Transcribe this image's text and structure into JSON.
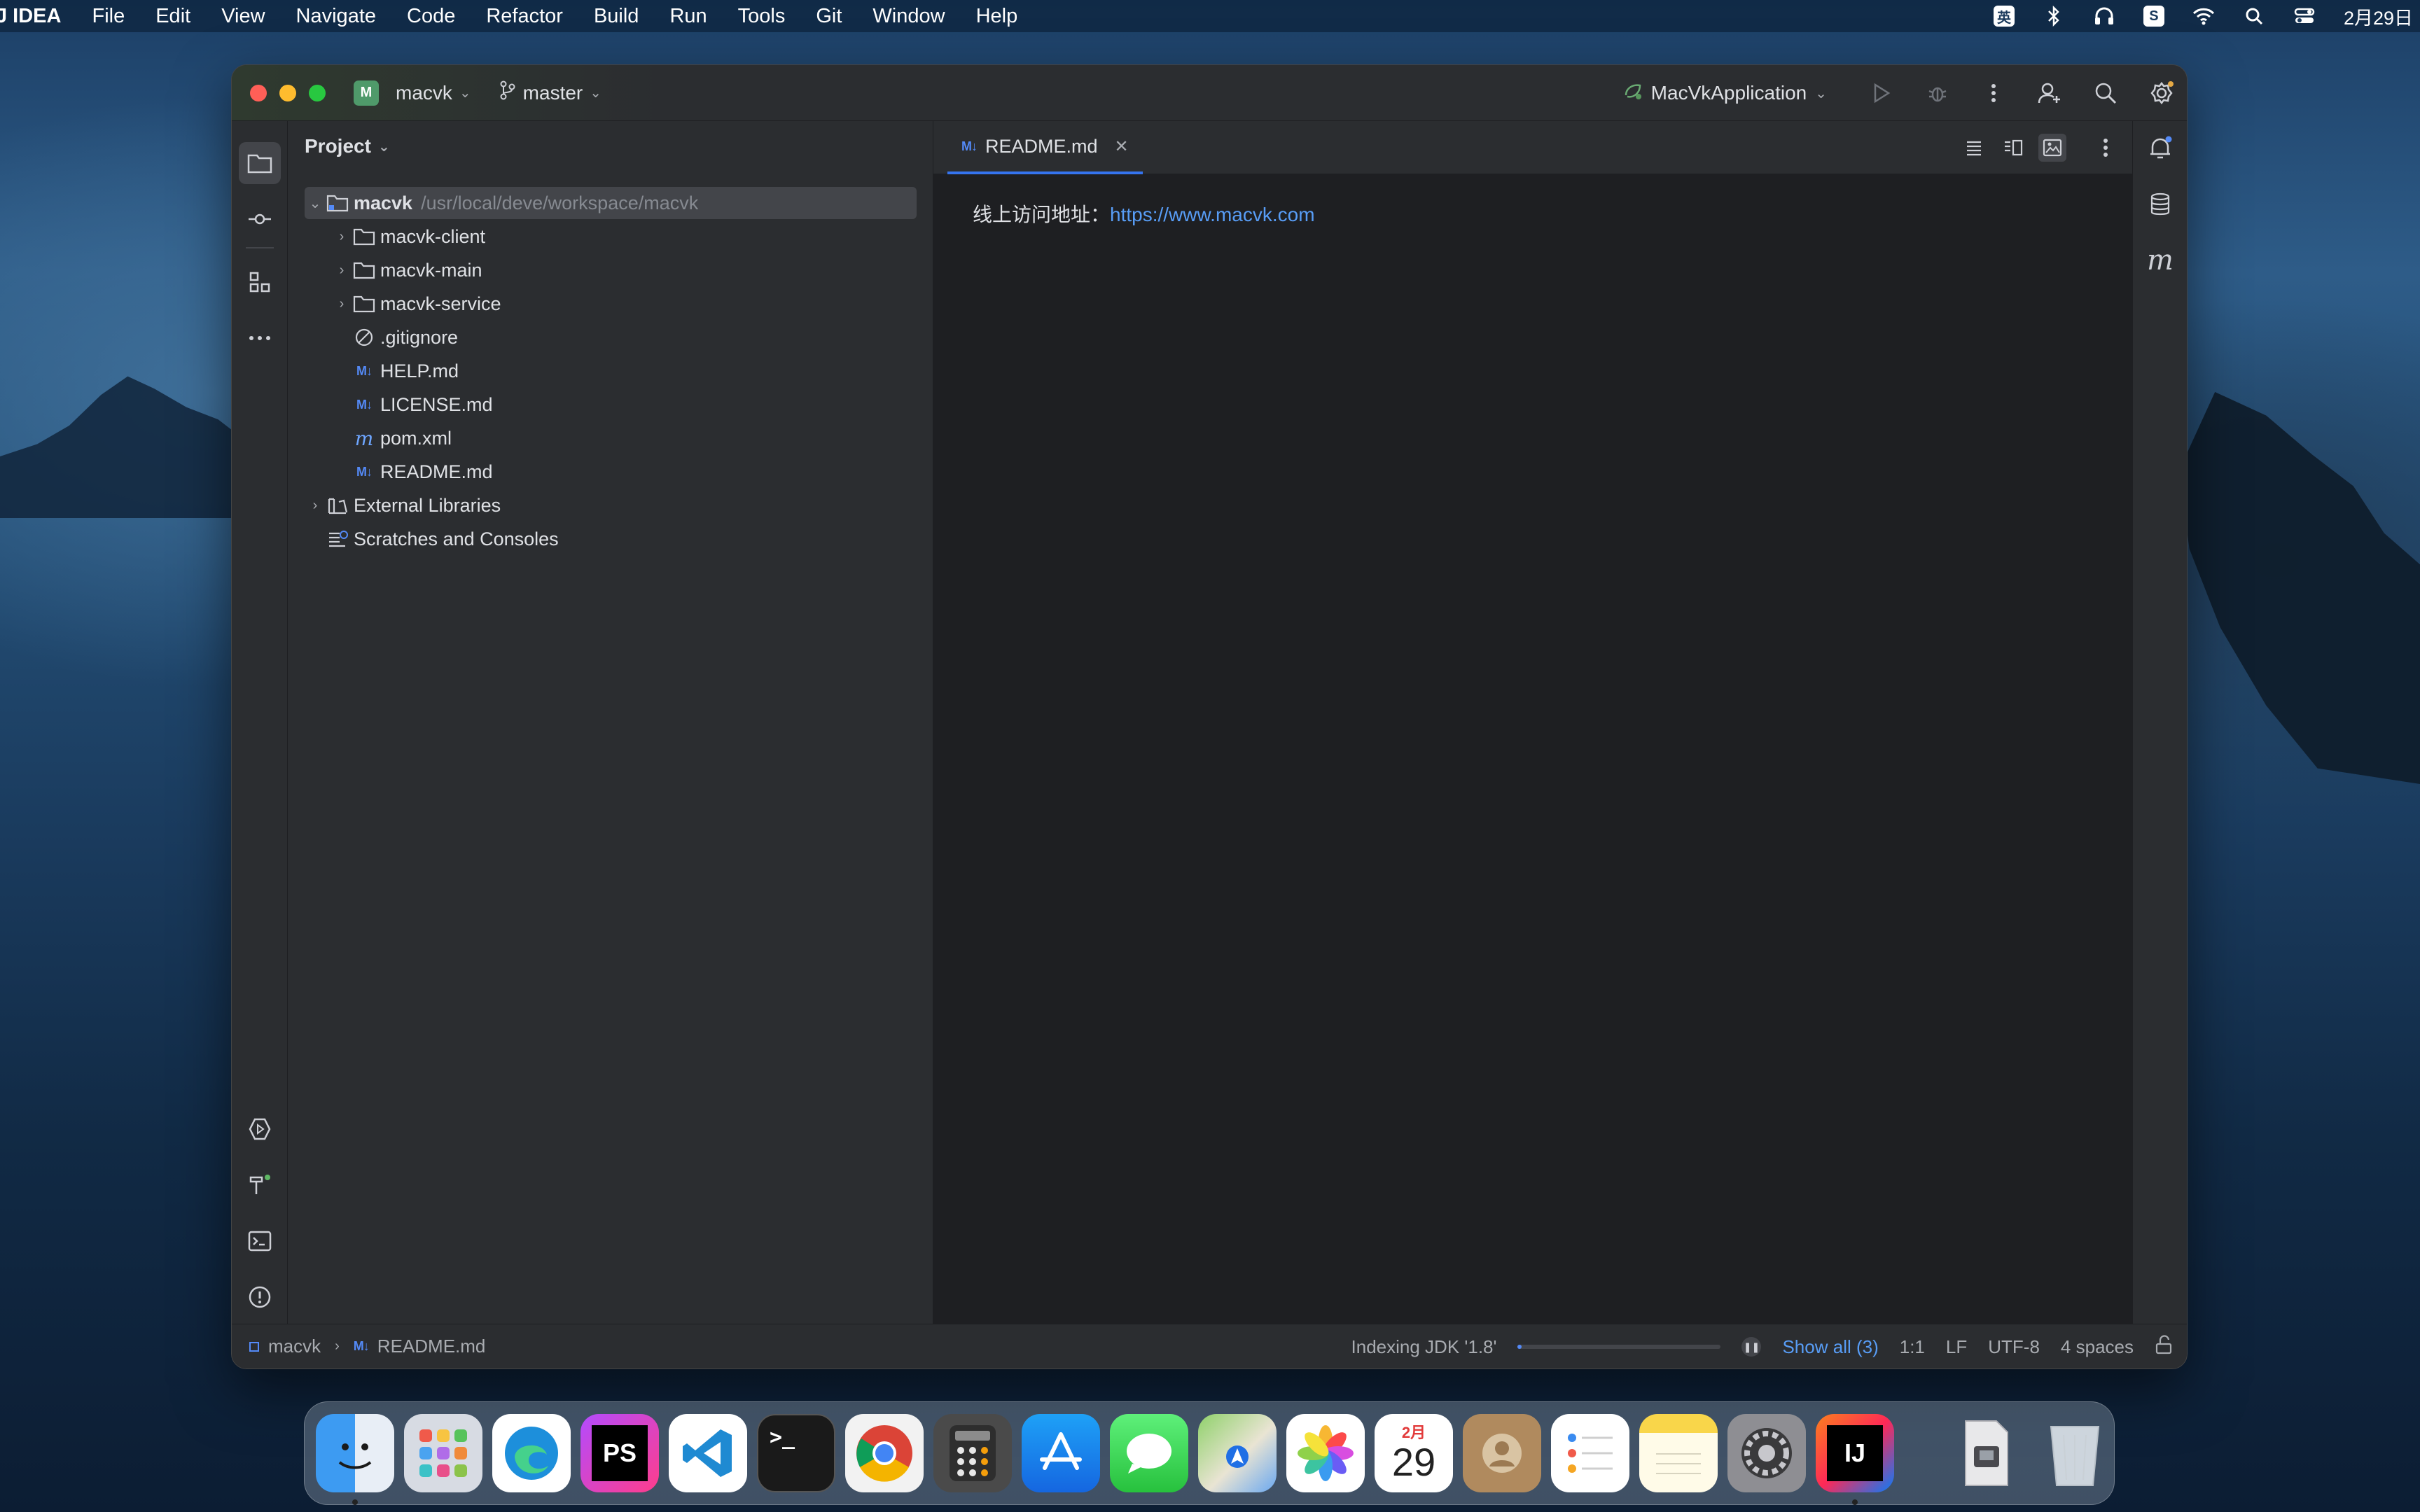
{
  "menubar": {
    "app_name": "J IDEA",
    "items": [
      "File",
      "Edit",
      "View",
      "Navigate",
      "Code",
      "Refactor",
      "Build",
      "Run",
      "Tools",
      "Git",
      "Window",
      "Help"
    ],
    "input_method": "英",
    "clock": "2月29日"
  },
  "titlebar": {
    "project_badge": "M",
    "project_name": "macvk",
    "branch": "master",
    "run_config": "MacVkApplication"
  },
  "project_panel": {
    "title": "Project",
    "root": {
      "name": "macvk",
      "path": "/usr/local/deve/workspace/macvk"
    },
    "items": [
      {
        "name": "macvk-client",
        "type": "folder"
      },
      {
        "name": "macvk-main",
        "type": "folder"
      },
      {
        "name": "macvk-service",
        "type": "folder"
      },
      {
        "name": ".gitignore",
        "type": "ignore-file"
      },
      {
        "name": "HELP.md",
        "type": "markdown"
      },
      {
        "name": "LICENSE.md",
        "type": "markdown"
      },
      {
        "name": "pom.xml",
        "type": "maven"
      },
      {
        "name": "README.md",
        "type": "markdown"
      }
    ],
    "external_libraries": "External Libraries",
    "scratches": "Scratches and Consoles"
  },
  "editor": {
    "tab_title": "README.md",
    "content_label": "线上访问地址：",
    "content_link": "https://www.macvk.com"
  },
  "statusbar": {
    "breadcrumb_project": "macvk",
    "breadcrumb_file": "README.md",
    "indexing": "Indexing JDK '1.8'",
    "indexing_progress": 0.02,
    "show_all": "Show all (3)",
    "position": "1:1",
    "line_sep": "LF",
    "encoding": "UTF-8",
    "indent": "4 spaces"
  },
  "dock": {
    "calendar_month": "2月",
    "calendar_day": "29",
    "phpstorm": "PS",
    "intellij": "IJ",
    "terminal": ">_"
  },
  "colors": {
    "accent": "#3574f0",
    "link": "#589df6",
    "panel_bg": "#2b2d30",
    "editor_bg": "#1e1f22"
  }
}
